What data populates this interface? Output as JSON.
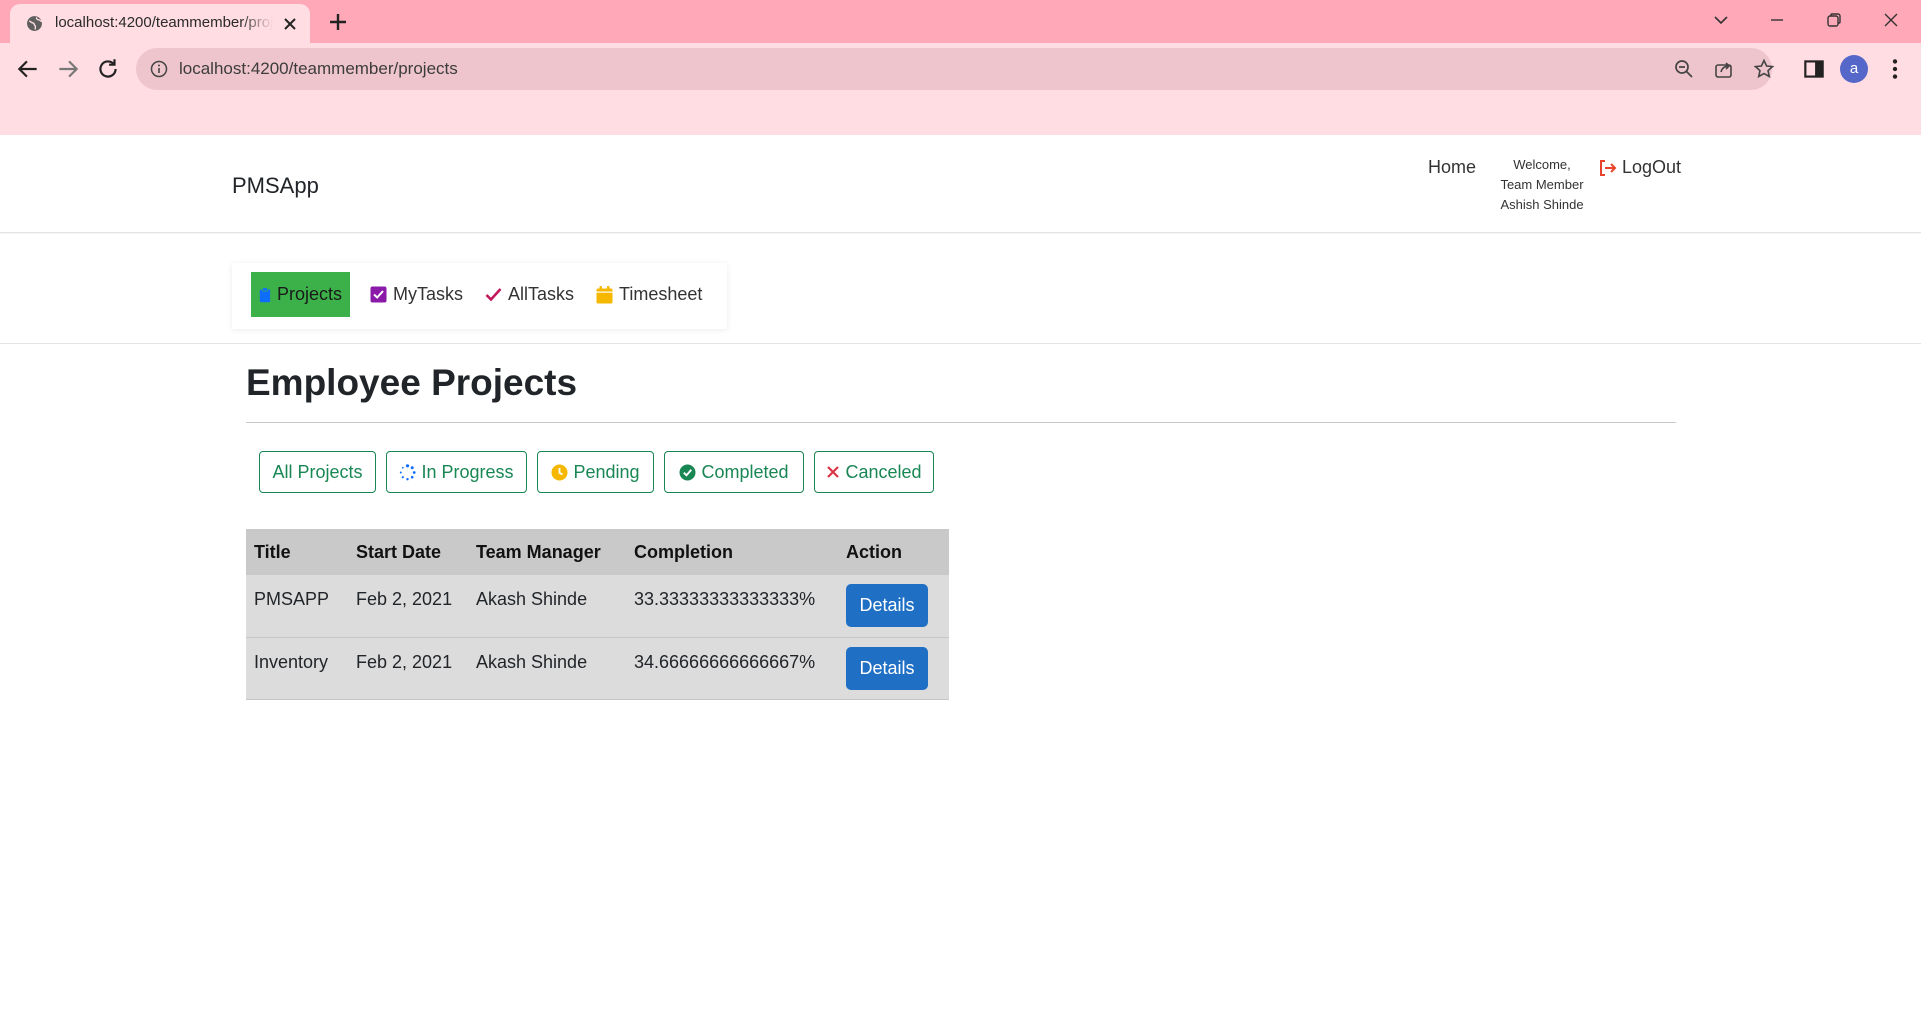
{
  "browser": {
    "tab_title": "localhost:4200/teammember/projects",
    "url": "localhost:4200/teammember/projects",
    "profile_initial": "a"
  },
  "app": {
    "brand": "PMSApp",
    "nav": {
      "home": "Home",
      "welcome_line1": "Welcome,",
      "welcome_line2": "Team Member",
      "welcome_line3": "Ashish Shinde",
      "logout": "LogOut"
    },
    "subnav": [
      {
        "label": "Projects",
        "icon": "clipboard-icon",
        "active": true
      },
      {
        "label": "MyTasks",
        "icon": "checkbox-icon",
        "active": false
      },
      {
        "label": "AllTasks",
        "icon": "check-icon",
        "active": false
      },
      {
        "label": "Timesheet",
        "icon": "calendar-icon",
        "active": false
      }
    ]
  },
  "main": {
    "title": "Employee Projects",
    "filters": [
      {
        "label": "All Projects"
      },
      {
        "label": "In Progress",
        "icon": "spinner-icon"
      },
      {
        "label": "Pending",
        "icon": "clock-icon"
      },
      {
        "label": "Completed",
        "icon": "check-circle-icon"
      },
      {
        "label": "Canceled",
        "icon": "x-icon"
      }
    ],
    "table": {
      "headers": [
        "Title",
        "Start Date",
        "Team Manager",
        "Completion",
        "Action"
      ],
      "rows": [
        {
          "title": "PMSAPP",
          "start_date": "Feb 2, 2021",
          "manager": "Akash Shinde",
          "completion": "33.33333333333333%",
          "action": "Details"
        },
        {
          "title": "Inventory",
          "start_date": "Feb 2, 2021",
          "manager": "Akash Shinde",
          "completion": "34.66666666666667%",
          "action": "Details"
        }
      ]
    }
  },
  "colors": {
    "tabstrip": "#ffa8b8",
    "toolbar": "#ffdde3",
    "active_nav": "#3cb14a",
    "success": "#198754",
    "primary": "#1f6fc5"
  }
}
